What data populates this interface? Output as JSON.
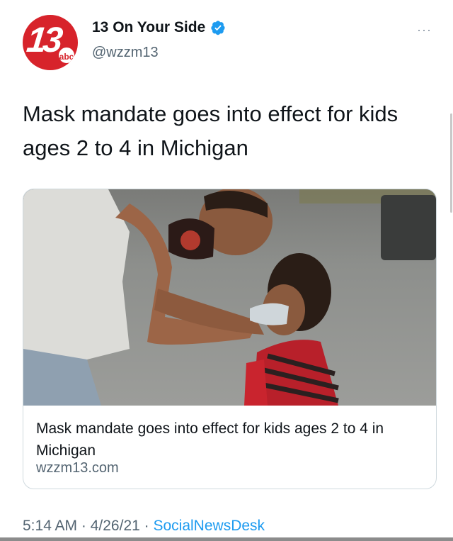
{
  "account": {
    "name": "13 On Your Side",
    "handle": "@wzzm13",
    "avatar_number": "13",
    "avatar_network": "abc",
    "verified_icon": "verified-badge-icon",
    "more_label": "···"
  },
  "tweet": {
    "text": "Mask mandate goes into effect for kids ages 2 to 4 in Michigan"
  },
  "card": {
    "title": "Mask mandate goes into effect for kids ages 2 to 4 in Michigan",
    "domain": "wzzm13.com"
  },
  "meta": {
    "time": "5:14 AM",
    "sep1": " · ",
    "date": "4/26/21",
    "sep2": " · ",
    "source": "SocialNewsDesk"
  },
  "colors": {
    "avatar_red": "#d7232b",
    "verified_blue": "#1d9bf0",
    "secondary_text": "#536471"
  }
}
